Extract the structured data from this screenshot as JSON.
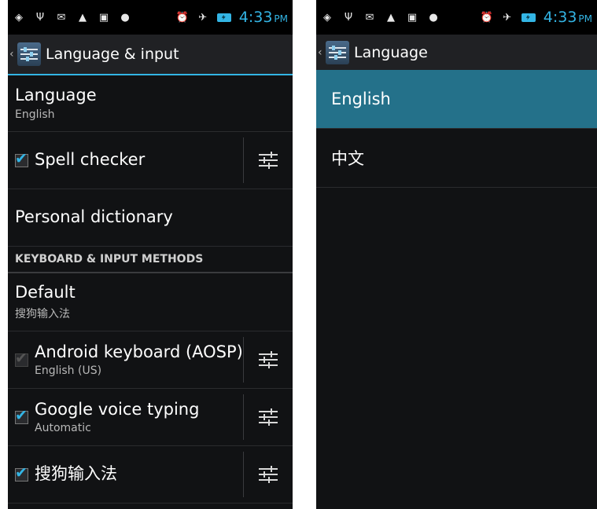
{
  "status_bar": {
    "time": "4:33",
    "ampm": "PM",
    "left_icons": [
      "gps-icon",
      "usb-icon",
      "gmail-icon",
      "warning-icon",
      "chat-icon",
      "android-icon"
    ],
    "right_icons": [
      "alarm-icon",
      "airplane-icon",
      "battery-charging-icon"
    ]
  },
  "left_screen": {
    "action_bar_title": "Language & input",
    "language": {
      "title": "Language",
      "summary": "English"
    },
    "spell_checker": {
      "title": "Spell checker",
      "checked": true
    },
    "personal_dictionary": {
      "title": "Personal dictionary"
    },
    "section_header": "KEYBOARD & INPUT METHODS",
    "default_ime": {
      "title": "Default",
      "summary": "搜狗输入法"
    },
    "ime_items": [
      {
        "title": "Android keyboard (AOSP)",
        "summary": "English (US)",
        "checked": true,
        "enabled": false
      },
      {
        "title": "Google voice typing",
        "summary": "Automatic",
        "checked": true,
        "enabled": true
      },
      {
        "title": "搜狗输入法",
        "summary": "",
        "checked": true,
        "enabled": true
      }
    ]
  },
  "right_screen": {
    "action_bar_title": "Language",
    "languages": [
      {
        "label": "English",
        "selected": true
      },
      {
        "label": "中文",
        "selected": false
      }
    ]
  },
  "colors": {
    "accent": "#33b5e5",
    "selected_row": "#24718a",
    "background": "#111214"
  }
}
